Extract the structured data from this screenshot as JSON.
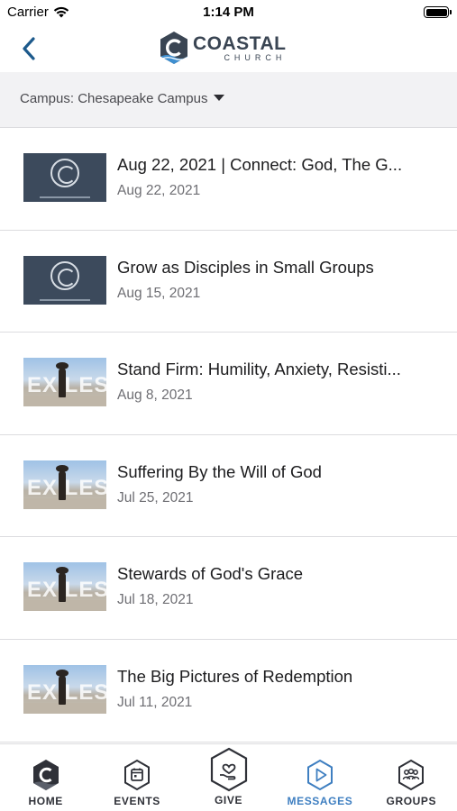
{
  "status_bar": {
    "carrier": "Carrier",
    "time": "1:14 PM"
  },
  "header": {
    "logo_name": "COASTAL",
    "logo_sub": "CHURCH"
  },
  "filter": {
    "campus_label": "Campus: Chesapeake Campus"
  },
  "messages": [
    {
      "title": "Aug 22, 2021 | Connect: God, The G...",
      "date": "Aug 22, 2021",
      "thumbnail": "connect"
    },
    {
      "title": "Grow as Disciples in Small Groups",
      "date": "Aug 15, 2021",
      "thumbnail": "connect"
    },
    {
      "title": "Stand Firm: Humility, Anxiety, Resisti...",
      "date": "Aug 8, 2021",
      "thumbnail": "exiles"
    },
    {
      "title": "Suffering By the Will of God",
      "date": "Jul 25, 2021",
      "thumbnail": "exiles"
    },
    {
      "title": "Stewards of God's Grace",
      "date": "Jul 18, 2021",
      "thumbnail": "exiles"
    },
    {
      "title": "The Big Pictures of Redemption",
      "date": "Jul 11, 2021",
      "thumbnail": "exiles"
    }
  ],
  "thumbnail_text": {
    "exiles": "EXILES"
  },
  "tabs": [
    {
      "label": "HOME",
      "icon": "home-hex-icon"
    },
    {
      "label": "EVENTS",
      "icon": "calendar-hex-icon"
    },
    {
      "label": "GIVE",
      "icon": "heart-hand-hex-icon"
    },
    {
      "label": "MESSAGES",
      "icon": "play-hex-icon",
      "active": true
    },
    {
      "label": "GROUPS",
      "icon": "people-hex-icon"
    }
  ],
  "colors": {
    "accent": "#3f7fc1",
    "logo": "#3a4553",
    "nav_back": "#1d5a8c"
  }
}
